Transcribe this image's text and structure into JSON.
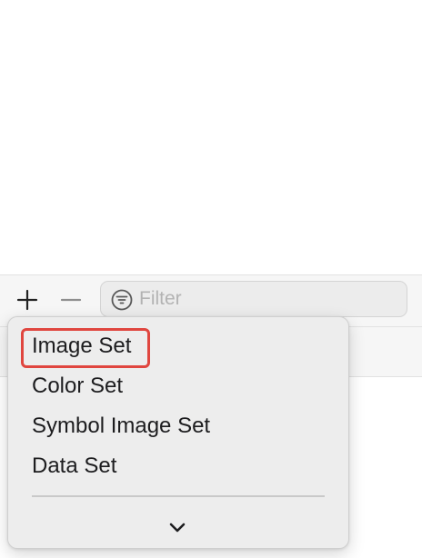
{
  "colors": {
    "highlight": "#e0463f",
    "menu_background": "#ededed",
    "bar_background": "#f6f6f6",
    "text": "#1d1d1f",
    "placeholder": "#b3b3b3"
  },
  "toolbar": {
    "add_icon": "plus-icon",
    "remove_icon": "minus-icon"
  },
  "filter": {
    "icon": "filter-icon",
    "value": "",
    "placeholder": "Filter"
  },
  "menu": {
    "items": [
      {
        "label": "Image Set",
        "highlighted": true
      },
      {
        "label": "Color Set"
      },
      {
        "label": "Symbol Image Set"
      },
      {
        "label": "Data Set"
      }
    ],
    "more_icon": "chevron-down-icon"
  }
}
